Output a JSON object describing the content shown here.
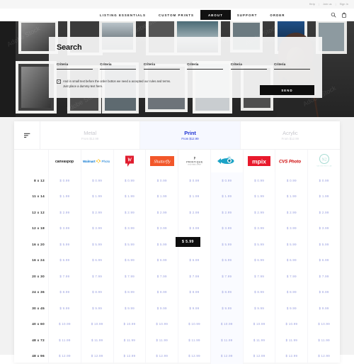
{
  "topbar": {
    "links": [
      "Help",
      "Join us",
      "Sign in"
    ],
    "separator": "|"
  },
  "nav": {
    "items": [
      {
        "label": "LISTING ESSENTIALS",
        "active": false
      },
      {
        "label": "CUSTOM PRINTS",
        "active": false
      },
      {
        "label": "ABOUT",
        "active": true
      },
      {
        "label": "SUPPORT",
        "active": false
      },
      {
        "label": "ORDER",
        "active": false
      }
    ],
    "icons": [
      "search-icon",
      "shopping-bag-icon"
    ]
  },
  "hero": {
    "description": "gallery wall with framed photographs",
    "watermark": "Adobe Stock"
  },
  "search": {
    "title": "Search",
    "criteria_label": "Criteria",
    "criteria_count": 6,
    "criteria_fields": [
      "Criteria",
      "Criteria",
      "Criteria",
      "Criteria",
      "Criteria",
      "Criteria"
    ],
    "terms_line1": "And in small text before the order botton we need a accepted our rules and terms.",
    "terms_line2": "Just place a dummy-text here.",
    "terms_checked": true,
    "send_label": "SEND"
  },
  "tabs": {
    "filter_icon": "filter-icon",
    "items": [
      {
        "name": "Metal",
        "sub": "From $12.99",
        "active": false
      },
      {
        "name": "Print",
        "sub": "From $12.99",
        "active": true
      },
      {
        "name": "Acrylic",
        "sub": "From $12.99",
        "active": false
      }
    ]
  },
  "table": {
    "brands": [
      "canvaspop",
      "Walmart Photo",
      "Walgreens",
      "Shutterfly",
      "Printique",
      "Bay Photo",
      "mpix",
      "CVS Photo",
      "Nations Photo Lab"
    ],
    "sizes": [
      "8 x 12",
      "11 x 14",
      "12 x 12",
      "12 x 18",
      "16 x 20",
      "16 x 24",
      "20 x 30",
      "24 x 36",
      "30 x 45",
      "40 x 60",
      "48 x 72",
      "48 x 96"
    ],
    "prices": [
      [
        "$ 0.99",
        "$ 0.99",
        "$ 0.99",
        "$ 0.99",
        "$ 0.99",
        "$ 0.99",
        "$ 0.99",
        "$ 0.99",
        "$ 0.99"
      ],
      [
        "$ 1.99",
        "$ 1.99",
        "$ 1.99",
        "$ 1.99",
        "$ 1.99",
        "$ 1.99",
        "$ 1.99",
        "$ 1.99",
        "$ 1.99"
      ],
      [
        "$ 2.99",
        "$ 2.99",
        "$ 2.99",
        "$ 2.99",
        "$ 2.99",
        "$ 2.99",
        "$ 2.99",
        "$ 2.99",
        "$ 2.99"
      ],
      [
        "$ 3.99",
        "$ 3.99",
        "$ 3.99",
        "$ 3.99",
        "$ 3.99",
        "$ 3.99",
        "$ 3.99",
        "$ 3.99",
        "$ 3.99"
      ],
      [
        "$ 5.99",
        "$ 5.99",
        "$ 5.99",
        "$ 5.99",
        "$ 5.99",
        "$ 5.99",
        "$ 5.99",
        "$ 5.99",
        "$ 5.99"
      ],
      [
        "$ 6.99",
        "$ 6.99",
        "$ 6.99",
        "$ 6.99",
        "$ 6.99",
        "$ 6.99",
        "$ 6.99",
        "$ 6.99",
        "$ 6.99"
      ],
      [
        "$ 7.99",
        "$ 7.99",
        "$ 7.99",
        "$ 7.99",
        "$ 7.99",
        "$ 7.99",
        "$ 7.99",
        "$ 7.99",
        "$ 7.99"
      ],
      [
        "$ 8.99",
        "$ 8.99",
        "$ 8.99",
        "$ 8.99",
        "$ 8.99",
        "$ 8.99",
        "$ 8.99",
        "$ 8.99",
        "$ 8.99"
      ],
      [
        "$ 9.99",
        "$ 9.99",
        "$ 9.99",
        "$ 9.99",
        "$ 9.99",
        "$ 9.99",
        "$ 9.99",
        "$ 9.99",
        "$ 9.99"
      ],
      [
        "$ 10.99",
        "$ 10.99",
        "$ 10.99",
        "$ 10.99",
        "$ 10.99",
        "$ 10.99",
        "$ 10.99",
        "$ 10.99",
        "$ 10.99"
      ],
      [
        "$ 11.99",
        "$ 11.99",
        "$ 11.99",
        "$ 11.99",
        "$ 11.99",
        "$ 11.99",
        "$ 11.99",
        "$ 11.99",
        "$ 11.99"
      ],
      [
        "$ 12.99",
        "$ 12.99",
        "$ 12.99",
        "$ 12.99",
        "$ 12.99",
        "$ 12.99",
        "$ 12.99",
        "$ 12.99",
        "$ 12.99"
      ]
    ],
    "tooltip": {
      "text": "$ 5.99",
      "row": "16 x 20",
      "column": "Bay Photo"
    }
  },
  "colors": {
    "accent_blue": "#2438d4",
    "price_text": "#9aa0e0",
    "dark": "#0d0d0d",
    "walgreens_red": "#e01b2d",
    "shutterfly_orange": "#f2572a",
    "mpix_red": "#e8192c",
    "cvs_red": "#cc0000",
    "bay_teal": "#1ba3c6",
    "nations_mint": "#a9ddd4"
  }
}
